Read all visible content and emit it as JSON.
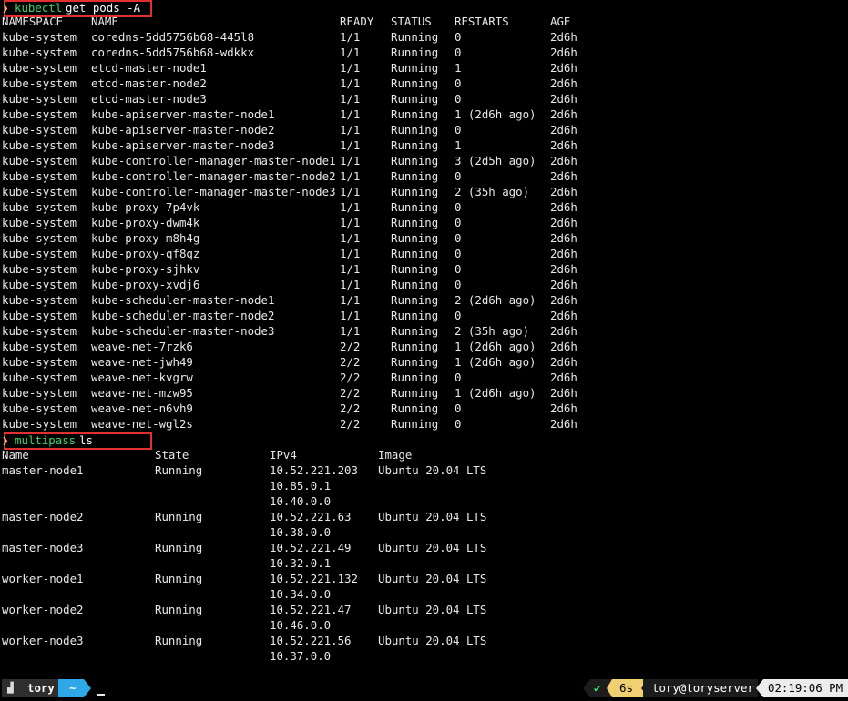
{
  "commands": {
    "kubectl": {
      "arrow": "❯",
      "bin": "kubectl",
      "args": "get pods -A"
    },
    "multipass": {
      "arrow": "❯",
      "bin": "multipass",
      "args": "ls"
    }
  },
  "pods": {
    "headers": [
      "NAMESPACE",
      "NAME",
      "READY",
      "STATUS",
      "RESTARTS",
      "AGE"
    ],
    "rows": [
      [
        "kube-system",
        "coredns-5dd5756b68-445l8",
        "1/1",
        "Running",
        "0",
        "2d6h"
      ],
      [
        "kube-system",
        "coredns-5dd5756b68-wdkkx",
        "1/1",
        "Running",
        "0",
        "2d6h"
      ],
      [
        "kube-system",
        "etcd-master-node1",
        "1/1",
        "Running",
        "1",
        "2d6h"
      ],
      [
        "kube-system",
        "etcd-master-node2",
        "1/1",
        "Running",
        "0",
        "2d6h"
      ],
      [
        "kube-system",
        "etcd-master-node3",
        "1/1",
        "Running",
        "0",
        "2d6h"
      ],
      [
        "kube-system",
        "kube-apiserver-master-node1",
        "1/1",
        "Running",
        "1 (2d6h ago)",
        "2d6h"
      ],
      [
        "kube-system",
        "kube-apiserver-master-node2",
        "1/1",
        "Running",
        "0",
        "2d6h"
      ],
      [
        "kube-system",
        "kube-apiserver-master-node3",
        "1/1",
        "Running",
        "1",
        "2d6h"
      ],
      [
        "kube-system",
        "kube-controller-manager-master-node1",
        "1/1",
        "Running",
        "3 (2d5h ago)",
        "2d6h"
      ],
      [
        "kube-system",
        "kube-controller-manager-master-node2",
        "1/1",
        "Running",
        "0",
        "2d6h"
      ],
      [
        "kube-system",
        "kube-controller-manager-master-node3",
        "1/1",
        "Running",
        "2 (35h ago)",
        "2d6h"
      ],
      [
        "kube-system",
        "kube-proxy-7p4vk",
        "1/1",
        "Running",
        "0",
        "2d6h"
      ],
      [
        "kube-system",
        "kube-proxy-dwm4k",
        "1/1",
        "Running",
        "0",
        "2d6h"
      ],
      [
        "kube-system",
        "kube-proxy-m8h4g",
        "1/1",
        "Running",
        "0",
        "2d6h"
      ],
      [
        "kube-system",
        "kube-proxy-qf8qz",
        "1/1",
        "Running",
        "0",
        "2d6h"
      ],
      [
        "kube-system",
        "kube-proxy-sjhkv",
        "1/1",
        "Running",
        "0",
        "2d6h"
      ],
      [
        "kube-system",
        "kube-proxy-xvdj6",
        "1/1",
        "Running",
        "0",
        "2d6h"
      ],
      [
        "kube-system",
        "kube-scheduler-master-node1",
        "1/1",
        "Running",
        "2 (2d6h ago)",
        "2d6h"
      ],
      [
        "kube-system",
        "kube-scheduler-master-node2",
        "1/1",
        "Running",
        "0",
        "2d6h"
      ],
      [
        "kube-system",
        "kube-scheduler-master-node3",
        "1/1",
        "Running",
        "2 (35h ago)",
        "2d6h"
      ],
      [
        "kube-system",
        "weave-net-7rzk6",
        "2/2",
        "Running",
        "1 (2d6h ago)",
        "2d6h"
      ],
      [
        "kube-system",
        "weave-net-jwh49",
        "2/2",
        "Running",
        "1 (2d6h ago)",
        "2d6h"
      ],
      [
        "kube-system",
        "weave-net-kvgrw",
        "2/2",
        "Running",
        "0",
        "2d6h"
      ],
      [
        "kube-system",
        "weave-net-mzw95",
        "2/2",
        "Running",
        "1 (2d6h ago)",
        "2d6h"
      ],
      [
        "kube-system",
        "weave-net-n6vh9",
        "2/2",
        "Running",
        "0",
        "2d6h"
      ],
      [
        "kube-system",
        "weave-net-wgl2s",
        "2/2",
        "Running",
        "0",
        "2d6h"
      ]
    ]
  },
  "instances": {
    "headers": [
      "Name",
      "State",
      "IPv4",
      "Image"
    ],
    "rows": [
      {
        "name": "master-node1",
        "state": "Running",
        "ipv4": [
          "10.52.221.203",
          "10.85.0.1",
          "10.40.0.0"
        ],
        "image": "Ubuntu 20.04 LTS"
      },
      {
        "name": "master-node2",
        "state": "Running",
        "ipv4": [
          "10.52.221.63",
          "10.38.0.0"
        ],
        "image": "Ubuntu 20.04 LTS"
      },
      {
        "name": "master-node3",
        "state": "Running",
        "ipv4": [
          "10.52.221.49",
          "10.32.0.1"
        ],
        "image": "Ubuntu 20.04 LTS"
      },
      {
        "name": "worker-node1",
        "state": "Running",
        "ipv4": [
          "10.52.221.132",
          "10.34.0.0"
        ],
        "image": "Ubuntu 20.04 LTS"
      },
      {
        "name": "worker-node2",
        "state": "Running",
        "ipv4": [
          "10.52.221.47",
          "10.46.0.0"
        ],
        "image": "Ubuntu 20.04 LTS"
      },
      {
        "name": "worker-node3",
        "state": "Running",
        "ipv4": [
          "10.52.221.56",
          "10.37.0.0"
        ],
        "image": "Ubuntu 20.04 LTS"
      }
    ]
  },
  "statusbar": {
    "os_icon": "apple-icon",
    "user": "tory",
    "dir": "~",
    "check": "✔",
    "duration": "6s",
    "host": "tory@toryserver",
    "time": "02:19:06 PM"
  },
  "colors": {
    "highlight_box": "#e03030",
    "command": "#3ad66a",
    "dir_segment": "#2fa8e8",
    "duration_segment": "#f0d070"
  }
}
